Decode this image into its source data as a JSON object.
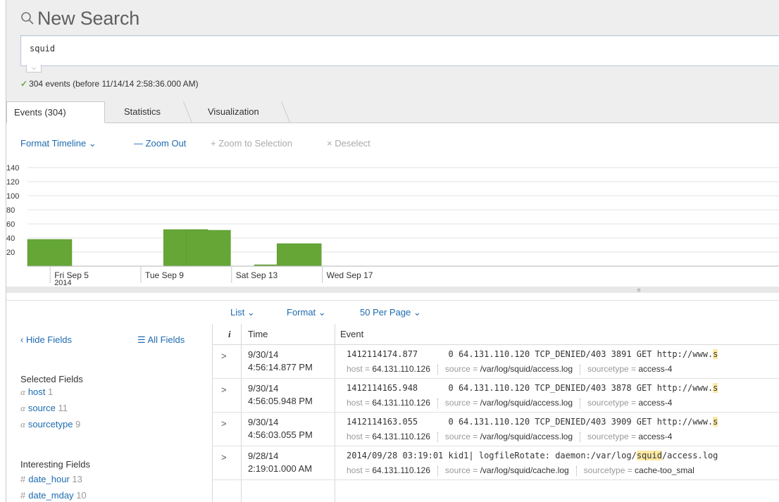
{
  "header": {
    "title": "New Search",
    "search_value": "squid",
    "status": "304 events (before 11/14/14 2:58:36.000 AM)"
  },
  "tabs": [
    {
      "label": "Events (304)"
    },
    {
      "label": "Statistics"
    },
    {
      "label": "Visualization"
    }
  ],
  "timeline_controls": {
    "format_timeline": "Format Timeline ⌄",
    "zoom_out": "— Zoom Out",
    "zoom_to_selection": "+ Zoom to Selection",
    "deselect": "× Deselect"
  },
  "chart_data": {
    "type": "bar",
    "yticks": [
      "140",
      "120",
      "100",
      "80",
      "60",
      "40",
      "20"
    ],
    "ylim": [
      0,
      140
    ],
    "xticks": [
      {
        "label": "Fri Sep 5",
        "sub": "2014"
      },
      {
        "label": "Tue Sep 9",
        "sub": ""
      },
      {
        "label": "Sat Sep 13",
        "sub": ""
      },
      {
        "label": "Wed Sep 17",
        "sub": ""
      }
    ],
    "bars": [
      {
        "day": "Sep 4",
        "value": 38
      },
      {
        "day": "Sep 10",
        "value": 52
      },
      {
        "day": "Sep 11",
        "value": 51
      },
      {
        "day": "Sep 14",
        "value": 2
      },
      {
        "day": "Sep 15",
        "value": 32
      }
    ],
    "bar_color": "#65a637"
  },
  "results_bar": {
    "list": "List ⌄",
    "format": "Format ⌄",
    "per_page": "50 Per Page ⌄"
  },
  "sidebar": {
    "hide_fields": "‹ Hide Fields",
    "all_fields": "☰ All Fields",
    "selected_heading": "Selected Fields",
    "selected": [
      {
        "type": "a",
        "name": "host",
        "count": "1"
      },
      {
        "type": "a",
        "name": "source",
        "count": "11"
      },
      {
        "type": "a",
        "name": "sourcetype",
        "count": "9"
      }
    ],
    "interesting_heading": "Interesting Fields",
    "interesting": [
      {
        "type": "#",
        "name": "date_hour",
        "count": "13"
      },
      {
        "type": "#",
        "name": "date_mday",
        "count": "10"
      }
    ]
  },
  "table": {
    "col_info": "i",
    "col_time": "Time",
    "col_event": "Event",
    "rows": [
      {
        "date": "9/30/14",
        "time": "4:56:14.877 PM",
        "raw_pre": "1412114174.877      0 64.131.110.120 TCP_DENIED/403 3891 GET http://www.",
        "raw_hl": "s",
        "raw_post": "",
        "host": "64.131.110.126",
        "source": "/var/log/squid/access.log",
        "sourcetype": "access-4"
      },
      {
        "date": "9/30/14",
        "time": "4:56:05.948 PM",
        "raw_pre": "1412114165.948      0 64.131.110.120 TCP_DENIED/403 3878 GET http://www.",
        "raw_hl": "s",
        "raw_post": "",
        "host": "64.131.110.126",
        "source": "/var/log/squid/access.log",
        "sourcetype": "access-4"
      },
      {
        "date": "9/30/14",
        "time": "4:56:03.055 PM",
        "raw_pre": "1412114163.055      0 64.131.110.120 TCP_DENIED/403 3909 GET http://www.",
        "raw_hl": "s",
        "raw_post": "",
        "host": "64.131.110.126",
        "source": "/var/log/squid/access.log",
        "sourcetype": "access-4"
      },
      {
        "date": "9/28/14",
        "time": "2:19:01.000 AM",
        "raw_pre": "2014/09/28 03:19:01 kid1| logfileRotate: daemon:/var/log/",
        "raw_hl": "squid",
        "raw_post": "/access.log",
        "host": "64.131.110.126",
        "source": "/var/log/squid/cache.log",
        "sourcetype": "cache-too_smal"
      }
    ],
    "meta_labels": {
      "host": "host = ",
      "source": "source = ",
      "sourcetype": "sourcetype = "
    }
  }
}
